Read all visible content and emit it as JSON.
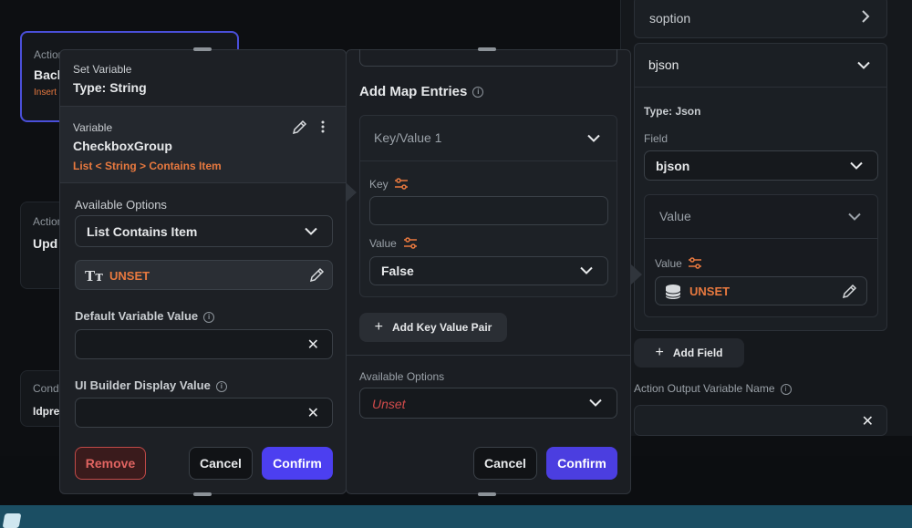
{
  "colors": {
    "accent": "#4c3ff0",
    "orange": "#e8793f",
    "danger": "#e06461",
    "background": "#0d0f12",
    "panel": "#1b1e23"
  },
  "canvas": {
    "card1": {
      "label": "Action",
      "title": "Back",
      "sub": "Insert"
    },
    "card2": {
      "label": "Action",
      "title": "Upd"
    },
    "card3": {
      "label": "Condi",
      "title": "Idpre"
    }
  },
  "set_variable": {
    "header_label": "Set Variable",
    "header_type": "Type: String",
    "variable_label": "Variable",
    "variable_name": "CheckboxGroup",
    "variable_path": "List < String > Contains Item",
    "available_options_label": "Available Options",
    "available_options_value": "List Contains Item",
    "unset_value": "UNSET",
    "default_value_label": "Default Variable Value",
    "ui_builder_label": "UI Builder Display Value",
    "remove_label": "Remove",
    "cancel_label": "Cancel",
    "confirm_label": "Confirm"
  },
  "map_entries": {
    "title": "Add Map Entries",
    "pair_title": "Key/Value 1",
    "key_label": "Key",
    "value_label": "Value",
    "value_selected": "False",
    "add_pair_label": "Add Key Value Pair",
    "available_options_label": "Available Options",
    "available_options_value": "Unset",
    "cancel_label": "Cancel",
    "confirm_label": "Confirm"
  },
  "right": {
    "soption_label": "soption",
    "bjson_label": "bjson",
    "type_label": "Type: Json",
    "field_label": "Field",
    "field_value": "bjson",
    "value_section_label": "Value",
    "value_label": "Value",
    "unset_value": "UNSET",
    "add_field_label": "Add Field",
    "output_var_label": "Action Output Variable Name"
  },
  "icons": {
    "edit": "pencil-icon",
    "more": "vertical-dots-icon",
    "chevron": "chevron-down-icon",
    "info": "info-icon",
    "text": "text-type-icon",
    "database": "database-icon",
    "settings": "sliders-icon",
    "close": "close-icon",
    "plus": "plus-icon"
  }
}
